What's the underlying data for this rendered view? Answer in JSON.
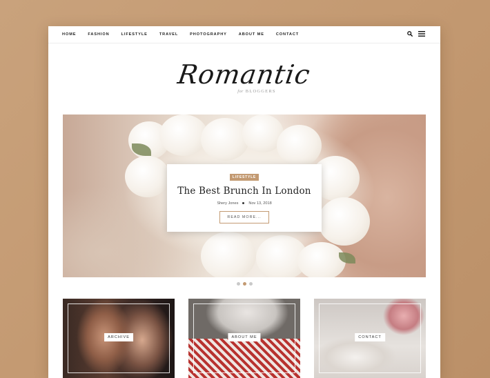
{
  "nav": {
    "items": [
      "HOME",
      "FASHION",
      "LIFESTYLE",
      "TRAVEL",
      "PHOTOGRAPHY",
      "ABOUT ME",
      "CONTACT"
    ],
    "search_icon": "search-icon",
    "menu_icon": "hamburger-menu-icon"
  },
  "brand": {
    "logo": "Romantic",
    "tagline_for": "for",
    "tagline": "BLOGGERS"
  },
  "featured": {
    "category": "LIFESTYLE",
    "title": "The Best Brunch In London",
    "author": "Shery Jones",
    "date": "Nov 13, 2018",
    "read_more": "READ MORE..."
  },
  "slider": {
    "count": 3,
    "active_index": 1
  },
  "tiles": [
    {
      "label": "ARCHIVE"
    },
    {
      "label": "ABOUT ME"
    },
    {
      "label": "CONTACT"
    }
  ],
  "colors": {
    "accent": "#c39a72",
    "background": "#c49a72",
    "page": "#ffffff"
  }
}
